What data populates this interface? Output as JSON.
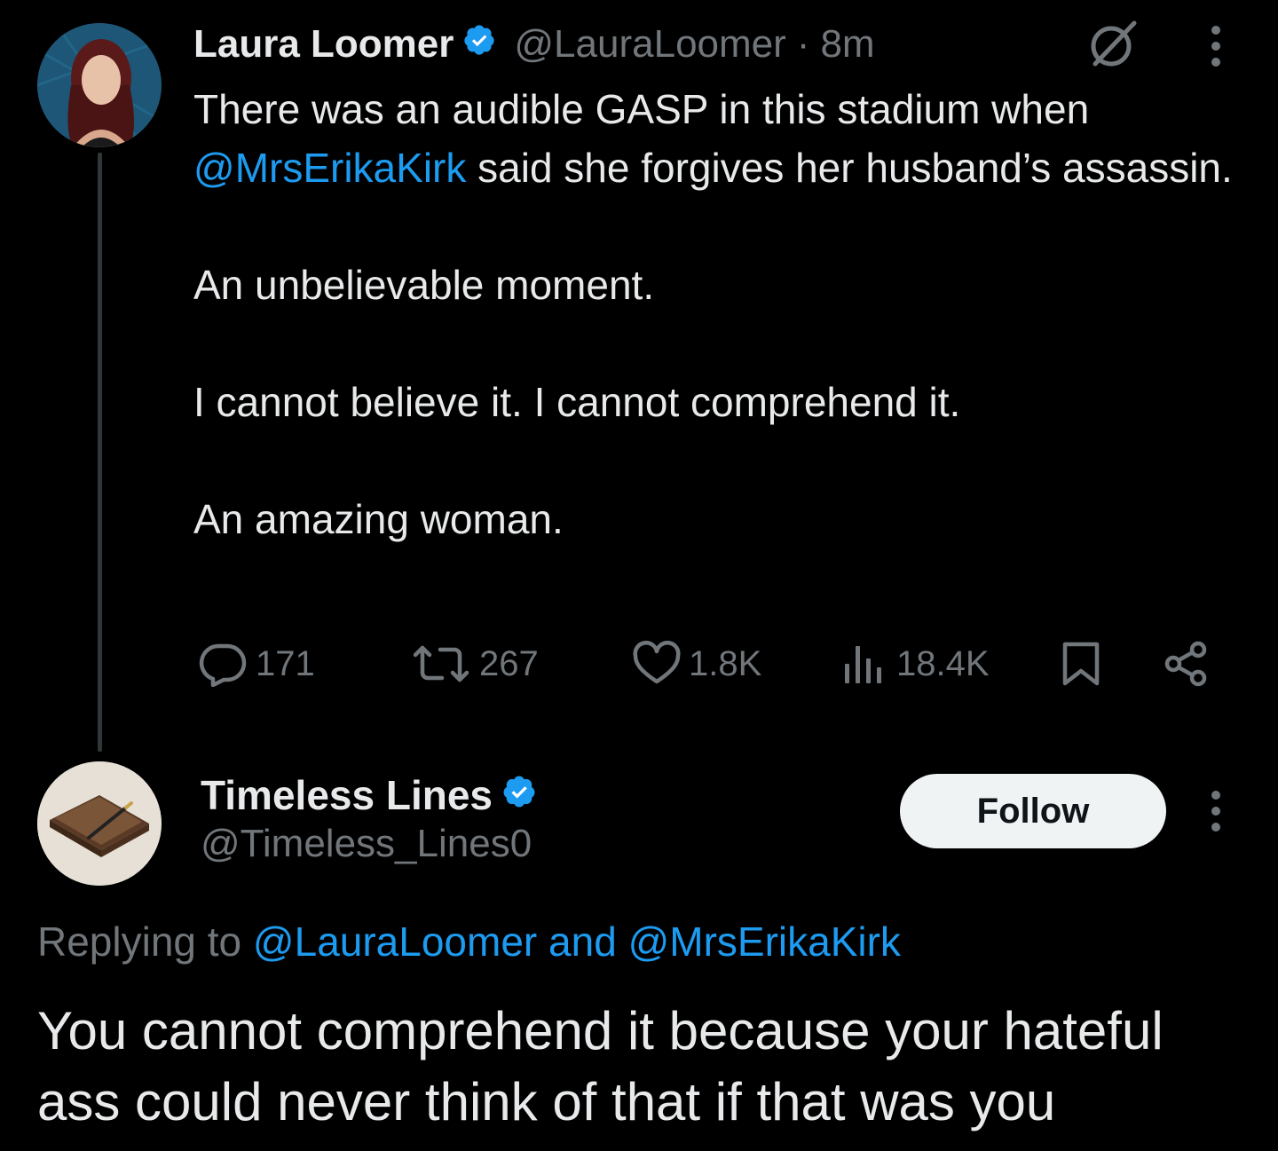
{
  "parent_tweet": {
    "display_name": "Laura Loomer",
    "handle": "@LauraLoomer",
    "separator": "·",
    "timestamp": "8m",
    "verified": true,
    "text": {
      "line_1_prefix": "There was an audible GASP in this stadium when",
      "mention": "@MrsErikaKirk",
      "line_1_suffix": "said she forgives her husband’s assassin.",
      "paragraph_2": "An unbelievable moment.",
      "paragraph_3": "I cannot believe it. I cannot comprehend it.",
      "paragraph_4": "An amazing woman."
    },
    "actions": {
      "replies": "171",
      "reposts": "267",
      "likes": "1.8K",
      "views": "18.4K"
    },
    "icons": [
      "grok-icon",
      "more-icon",
      "reply-icon",
      "repost-icon",
      "like-icon",
      "views-icon",
      "bookmark-icon",
      "share-icon"
    ]
  },
  "reply": {
    "display_name": "Timeless Lines",
    "handle": "@Timeless_Lines0",
    "verified": true,
    "follow_label": "Follow",
    "replying_to": {
      "prefix": "Replying to",
      "mention_1": "@LauraLoomer",
      "conjunction": "and",
      "mention_2": "@MrsErikaKirk"
    },
    "text": "You cannot comprehend it because your hateful ass could never think of that if that was you"
  },
  "colors": {
    "background": "#000000",
    "text_primary": "#e7e9ea",
    "text_secondary": "#71767b",
    "accent": "#1d9bf0",
    "thread_line": "#333639",
    "follow_button_bg": "#eff3f4"
  }
}
